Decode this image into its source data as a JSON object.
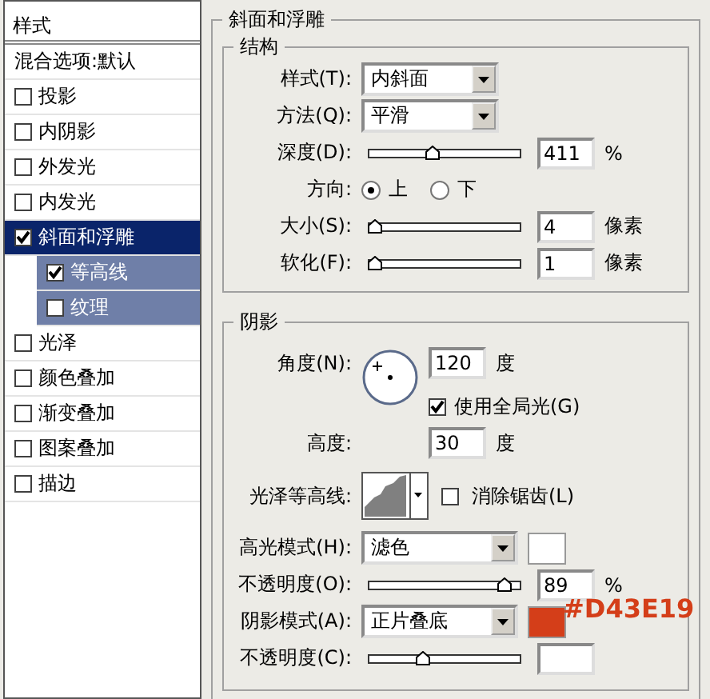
{
  "styles_panel": {
    "title": "样式",
    "items": [
      {
        "label": "混合选项:默认",
        "kind": "header",
        "selected": false
      },
      {
        "label": "投影",
        "kind": "effect",
        "checked": false,
        "selected": false
      },
      {
        "label": "内阴影",
        "kind": "effect",
        "checked": false,
        "selected": false
      },
      {
        "label": "外发光",
        "kind": "effect",
        "checked": false,
        "selected": false
      },
      {
        "label": "内发光",
        "kind": "effect",
        "checked": false,
        "selected": false
      },
      {
        "label": "斜面和浮雕",
        "kind": "effect",
        "checked": true,
        "selected": true,
        "children": [
          {
            "label": "等高线",
            "checked": true
          },
          {
            "label": "纹理",
            "checked": false
          }
        ]
      },
      {
        "label": "光泽",
        "kind": "effect",
        "checked": false,
        "selected": false
      },
      {
        "label": "颜色叠加",
        "kind": "effect",
        "checked": false,
        "selected": false
      },
      {
        "label": "渐变叠加",
        "kind": "effect",
        "checked": false,
        "selected": false
      },
      {
        "label": "图案叠加",
        "kind": "effect",
        "checked": false,
        "selected": false
      },
      {
        "label": "描边",
        "kind": "effect",
        "checked": false,
        "selected": false
      }
    ]
  },
  "bevel": {
    "title": "斜面和浮雕",
    "structure": {
      "title": "结构",
      "rows": [
        {
          "kind": "select",
          "label": "样式(T):",
          "value": "内斜面"
        },
        {
          "kind": "select",
          "label": "方法(Q):",
          "value": "平滑"
        },
        {
          "kind": "slider",
          "label": "深度(D):",
          "level": 0.41,
          "value": "411",
          "unit": "%"
        },
        {
          "kind": "radio",
          "label": "方向:",
          "options": [
            {
              "label": "上",
              "selected": true
            },
            {
              "label": "下",
              "selected": false
            }
          ]
        },
        {
          "kind": "slider",
          "label": "大小(S):",
          "level": 0.03,
          "value": "4",
          "unit": "像素"
        },
        {
          "kind": "slider",
          "label": "软化(F):",
          "level": 0.03,
          "value": "1",
          "unit": "像素"
        }
      ]
    },
    "shading": {
      "title": "阴影",
      "angle_label": "角度(N):",
      "angle": "120",
      "angle_unit": "度",
      "global_light": {
        "label": "使用全局光(G)",
        "checked": true
      },
      "altitude_label": "高度:",
      "altitude": "30",
      "altitude_unit": "度",
      "gloss_label": "光泽等高线:",
      "anti_alias": {
        "label": "消除锯齿(L)",
        "checked": false
      },
      "rows": [
        {
          "kind": "select",
          "label": "高光模式(H):",
          "value": "滤色",
          "color": "#ffffff"
        },
        {
          "kind": "slider",
          "label": "不透明度(O):",
          "level": 0.89,
          "value": "89",
          "unit": "%"
        },
        {
          "kind": "select",
          "label": "阴影模式(A):",
          "value": "正片叠底",
          "color": "#d43e19"
        },
        {
          "kind": "slider",
          "label": "不透明度(C):",
          "level": 0.35
        }
      ]
    }
  },
  "annotation": "#D43E19"
}
